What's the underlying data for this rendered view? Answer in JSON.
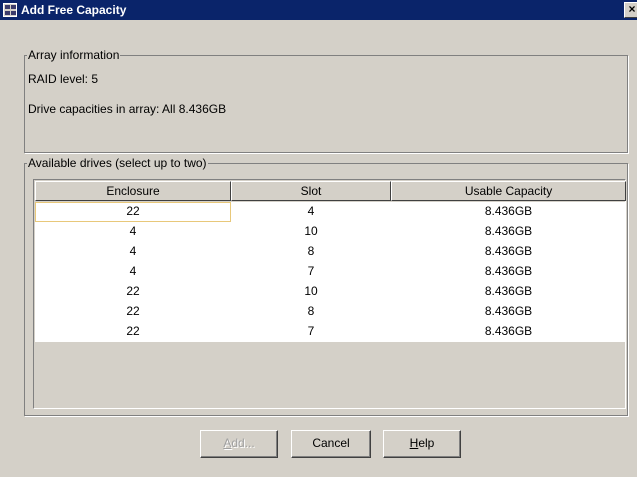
{
  "window": {
    "title": "Add Free Capacity",
    "close_glyph": "×"
  },
  "array_info": {
    "legend": "Array information",
    "raid_level": "RAID level: 5",
    "drive_capacities": "Drive capacities in array: All 8.436GB"
  },
  "drives": {
    "legend": "Available drives (select up to two)",
    "columns": [
      "Enclosure",
      "Slot",
      "Usable Capacity"
    ],
    "rows": [
      [
        "22",
        "4",
        "8.436GB"
      ],
      [
        "4",
        "10",
        "8.436GB"
      ],
      [
        "4",
        "8",
        "8.436GB"
      ],
      [
        "4",
        "7",
        "8.436GB"
      ],
      [
        "22",
        "10",
        "8.436GB"
      ],
      [
        "22",
        "8",
        "8.436GB"
      ],
      [
        "22",
        "7",
        "8.436GB"
      ]
    ]
  },
  "buttons": {
    "add": {
      "label": "Add...",
      "mnemonic": "A",
      "rest": "dd...",
      "enabled": false
    },
    "cancel": {
      "label": "Cancel"
    },
    "help": {
      "label": "Help",
      "mnemonic": "H",
      "rest": "elp"
    }
  },
  "colors": {
    "title_bar": "#0a246a",
    "dialog_bg": "#d4d0c8",
    "focus_border": "#e8c87a"
  }
}
